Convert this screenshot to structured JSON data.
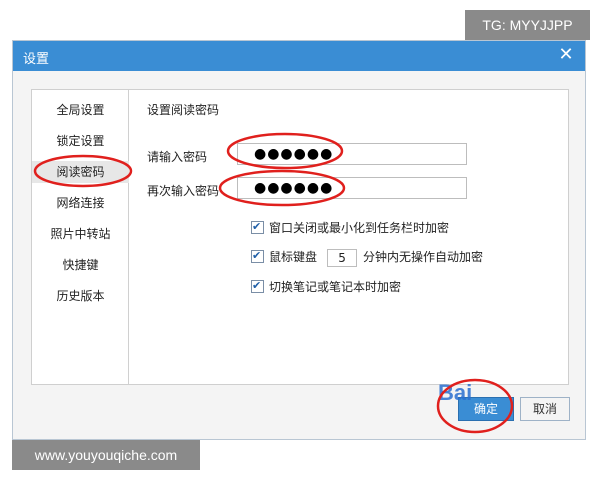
{
  "watermarks": {
    "top_right": "TG: MYYJJPP",
    "bottom_left": "www.youyouqiche.com"
  },
  "dialog": {
    "title": "设置",
    "close_glyph": "✕"
  },
  "sidebar": {
    "items": [
      {
        "label": "全局设置",
        "active": false
      },
      {
        "label": "锁定设置",
        "active": false
      },
      {
        "label": "阅读密码",
        "active": true
      },
      {
        "label": "网络连接",
        "active": false
      },
      {
        "label": "照片中转站",
        "active": false
      },
      {
        "label": "快捷键",
        "active": false
      },
      {
        "label": "历史版本",
        "active": false
      }
    ]
  },
  "content": {
    "section_title": "设置阅读密码",
    "password_label": "请输入密码",
    "password_value": "●●●●●●",
    "confirm_label": "再次输入密码",
    "confirm_value": "●●●●●●",
    "options": [
      {
        "label": "窗口关闭或最小化到任务栏时加密",
        "checked": true
      },
      {
        "label_prefix": "鼠标键盘",
        "minutes": "5",
        "label_suffix": "分钟内无操作自动加密",
        "checked": true
      },
      {
        "label": "切换笔记或笔记本时加密",
        "checked": true
      }
    ],
    "check_glyph": "✔"
  },
  "buttons": {
    "ok": "确定",
    "cancel": "取消"
  },
  "annotation_color": "#e0201d",
  "accent_color": "#3a8dd4"
}
